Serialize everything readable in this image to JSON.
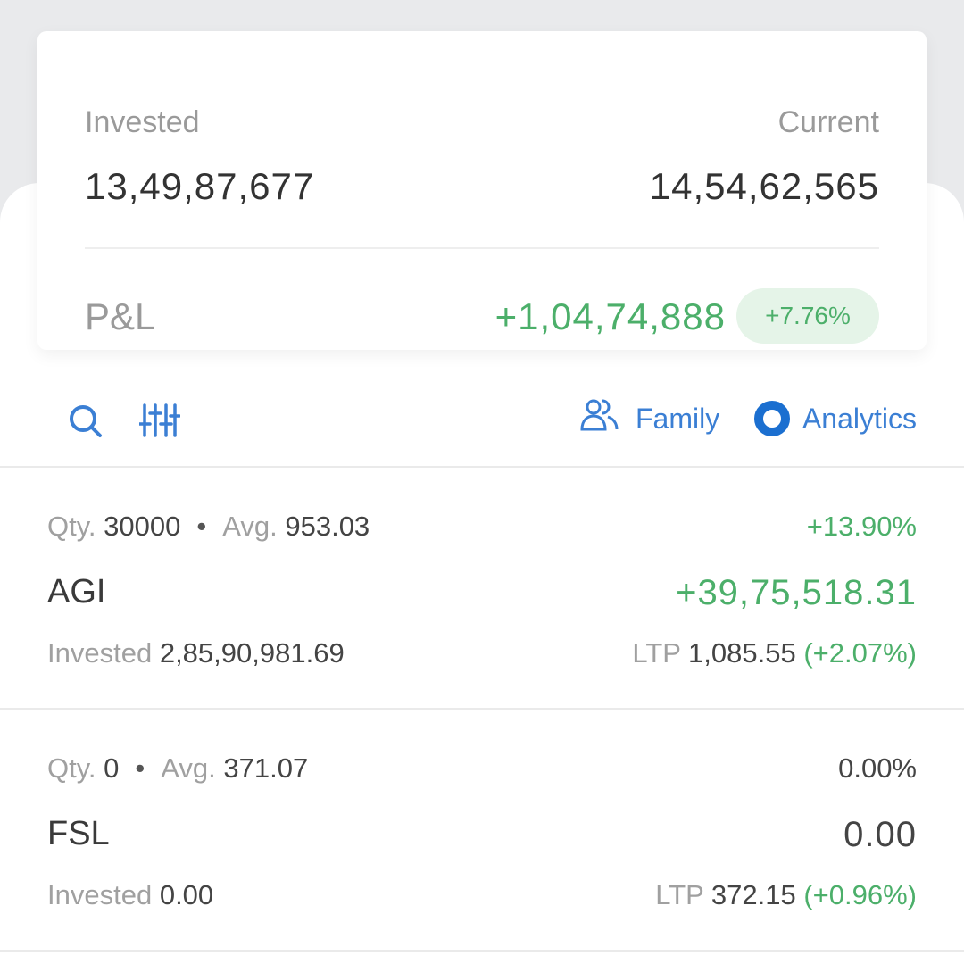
{
  "summary": {
    "invested_label": "Invested",
    "invested_value": "13,49,87,677",
    "current_label": "Current",
    "current_value": "14,54,62,565",
    "pnl_label": "P&L",
    "pnl_value": "+1,04,74,888",
    "pnl_percent": "+7.76%"
  },
  "toolbar": {
    "search_icon": "search-icon",
    "filter_icon": "sliders-icon",
    "family_label": "Family",
    "analytics_label": "Analytics"
  },
  "holdings": [
    {
      "qty_label": "Qty.",
      "qty": "30000",
      "avg_label": "Avg.",
      "avg": "953.03",
      "change_pct": "+13.90%",
      "symbol": "AGI",
      "pnl": "+39,75,518.31",
      "invested_label": "Invested",
      "invested": "2,85,90,981.69",
      "ltp_label": "LTP",
      "ltp": "1,085.55",
      "ltp_change": "(+2.07%)"
    },
    {
      "qty_label": "Qty.",
      "qty": "0",
      "avg_label": "Avg.",
      "avg": "371.07",
      "change_pct": "0.00%",
      "symbol": "FSL",
      "pnl": "0.00",
      "invested_label": "Invested",
      "invested": "0.00",
      "ltp_label": "LTP",
      "ltp": "372.15",
      "ltp_change": "(+0.96%)"
    }
  ],
  "colors": {
    "profit": "#4caf6a",
    "accent": "#3b7fd4",
    "background": "#e9eaec"
  }
}
